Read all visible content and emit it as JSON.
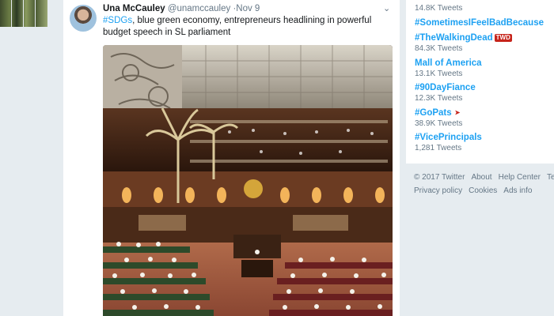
{
  "tweet": {
    "name": "Una McCauley",
    "handle": "@unamccauley",
    "time": "·Nov 9",
    "hashtag": "#SDGs",
    "text": ", blue green economy, entrepreneurs headlining in powerful budget speech in SL parliament",
    "caret_icon": "chevron-down-icon"
  },
  "trends": [
    {
      "name": "",
      "count": "14.8K Tweets"
    },
    {
      "name": "#SometimesIFeelBadBecause",
      "count": ""
    },
    {
      "name": "#TheWalkingDead",
      "count": "84.3K Tweets",
      "badge": "TWD"
    },
    {
      "name": "Mall of America",
      "count": "13.1K Tweets"
    },
    {
      "name": "#90DayFiance",
      "count": "12.3K Tweets"
    },
    {
      "name": "#GoPats",
      "count": "38.9K Tweets",
      "badge": "➤"
    },
    {
      "name": "#VicePrincipals",
      "count": "1,281 Tweets"
    }
  ],
  "footer": {
    "copyright": "© 2017 Twitter",
    "about": "About",
    "help": "Help Center",
    "terms": "Terms",
    "privacy": "Privacy policy",
    "cookies": "Cookies",
    "ads": "Ads info"
  },
  "colors": {
    "link": "#1da1f2",
    "muted": "#657786",
    "background": "#e6ecf0"
  }
}
